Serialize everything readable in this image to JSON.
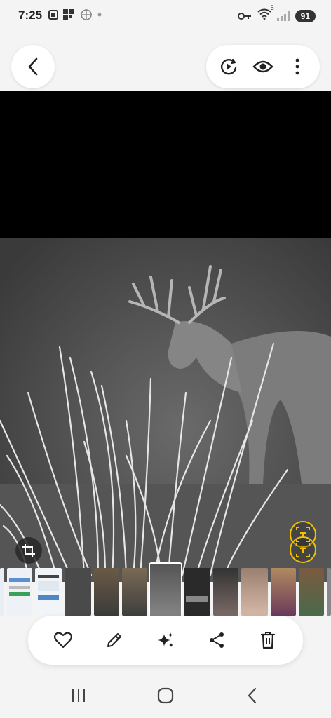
{
  "status_bar": {
    "time": "7:25",
    "battery": "91",
    "wifi_badge": "5"
  },
  "top_bar": {
    "icons": [
      "back-arrow-icon",
      "motion-photo-play-icon",
      "eye-icon",
      "more-vertical-icon"
    ]
  },
  "photo": {
    "description_icon": "crop-icon",
    "overlay_icon": "visual-lookup-icon",
    "accent_color": "#f2c200"
  },
  "filmstrip": {
    "active_index": 5,
    "thumbnail_count": 12
  },
  "toolbar": {
    "icons": [
      "heart-icon",
      "pencil-icon",
      "sparkles-icon",
      "share-icon",
      "trash-icon"
    ]
  },
  "navbar": {
    "icons": [
      "recent-apps-icon",
      "home-icon",
      "back-icon"
    ]
  }
}
